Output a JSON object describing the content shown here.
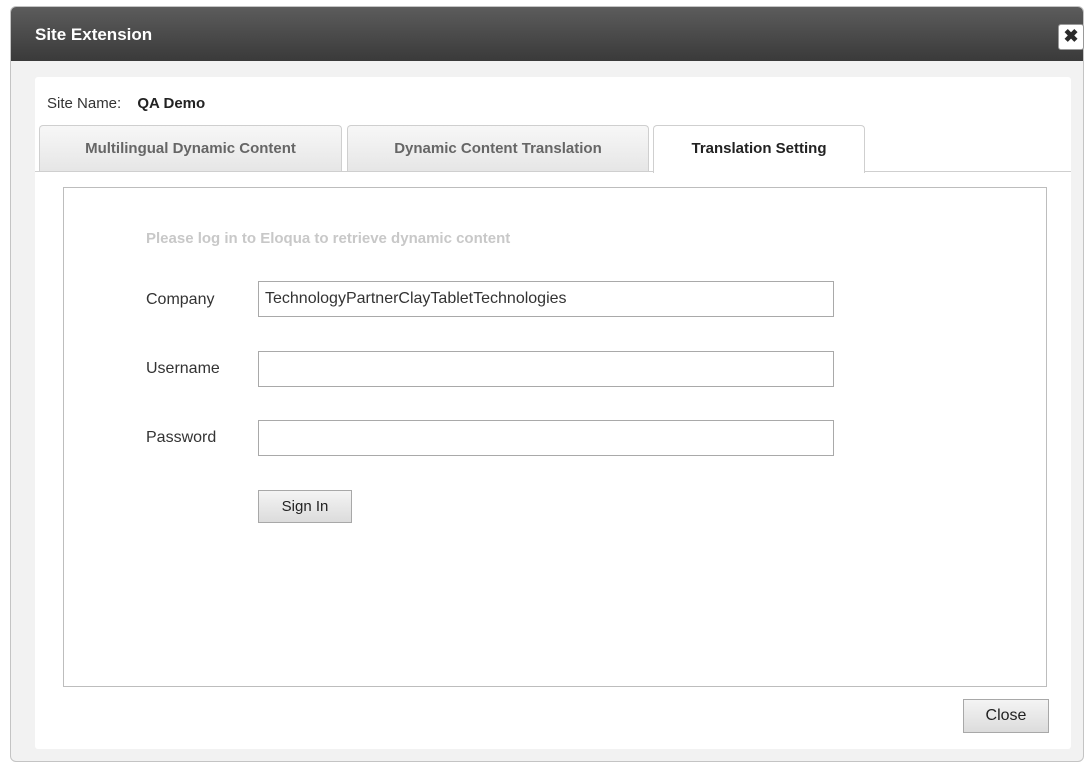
{
  "dialog": {
    "title": "Site Extension",
    "close_icon_glyph": "✖"
  },
  "site": {
    "label": "Site Name:",
    "value": "QA Demo"
  },
  "tabs": [
    {
      "label": "Multilingual Dynamic Content",
      "active": false
    },
    {
      "label": "Dynamic Content Translation",
      "active": false
    },
    {
      "label": "Translation Setting",
      "active": true
    }
  ],
  "form": {
    "notice": "Please log in to Eloqua to retrieve dynamic content",
    "company_label": "Company",
    "company_value": "TechnologyPartnerClayTabletTechnologies",
    "username_label": "Username",
    "username_value": "",
    "password_label": "Password",
    "password_value": "",
    "signin_label": "Sign In"
  },
  "footer": {
    "close_label": "Close"
  },
  "colors": {
    "titlebar": "#4a4a4a",
    "notice_text": "#c8c8c8"
  }
}
